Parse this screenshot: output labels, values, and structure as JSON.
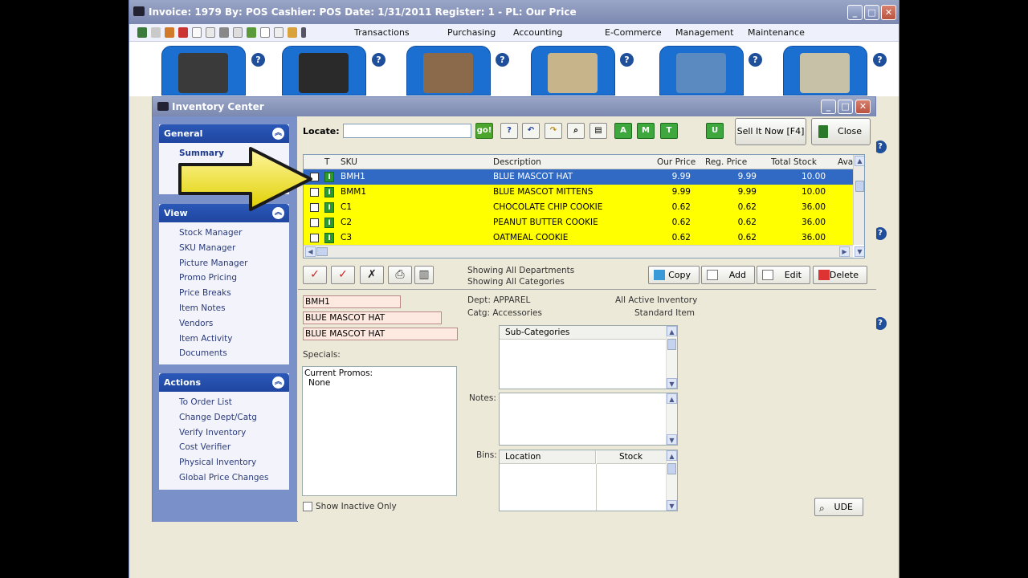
{
  "outer": {
    "title": "Invoice: 1979  By: POS  Cashier: POS  Date:  1/31/2011  Register: 1 - PL: Our Price",
    "menu": [
      "Transactions",
      "Purchasing",
      "Accounting",
      "E-Commerce",
      "Management",
      "Maintenance"
    ],
    "help": "?"
  },
  "window": {
    "title": "Inventory Center"
  },
  "sidebar": {
    "general": {
      "title": "General",
      "items": [
        "Summary",
        "De",
        "Ma"
      ]
    },
    "view": {
      "title": "View",
      "items": [
        "Stock Manager",
        "SKU Manager",
        "Picture Manager",
        "Promo Pricing",
        "Price Breaks",
        "Item Notes",
        "Vendors",
        "Item Activity",
        "Documents"
      ]
    },
    "actions": {
      "title": "Actions",
      "items": [
        "To Order List",
        "Change Dept/Catg",
        "Verify Inventory",
        "Cost Verifier",
        "Physical Inventory",
        "Global Price Changes"
      ]
    }
  },
  "toolbar": {
    "locate_label": "Locate:",
    "locate_value": "",
    "go": "go!",
    "btn_a": "A",
    "btn_m": "M",
    "btn_t": "T",
    "btn_u": "U",
    "sell_it_now": "Sell It Now [F4]",
    "close": "Close"
  },
  "grid": {
    "headers": {
      "t": "T",
      "sku": "SKU",
      "desc": "Description",
      "our": "Our Price",
      "reg": "Reg. Price",
      "stock": "Total Stock",
      "avail": "Ava"
    },
    "rows": [
      {
        "sku": "BMH1",
        "desc": "BLUE MASCOT HAT",
        "our": "9.99",
        "reg": "9.99",
        "stock": "10.00",
        "type": "I"
      },
      {
        "sku": "BMM1",
        "desc": "BLUE MASCOT MITTENS",
        "our": "9.99",
        "reg": "9.99",
        "stock": "10.00",
        "type": "I"
      },
      {
        "sku": "C1",
        "desc": "CHOCOLATE CHIP COOKIE",
        "our": "0.62",
        "reg": "0.62",
        "stock": "36.00",
        "type": "I"
      },
      {
        "sku": "C2",
        "desc": "PEANUT BUTTER COOKIE",
        "our": "0.62",
        "reg": "0.62",
        "stock": "36.00",
        "type": "I"
      },
      {
        "sku": "C3",
        "desc": "OATMEAL COOKIE",
        "our": "0.62",
        "reg": "0.62",
        "stock": "36.00",
        "type": "I"
      }
    ]
  },
  "filters": {
    "line1": "Showing All Departments",
    "line2": "Showing All Categories"
  },
  "actions_bar": {
    "copy": "Copy",
    "add": "Add",
    "edit": "Edit",
    "delete": "Delete"
  },
  "detail": {
    "sku": "BMH1",
    "desc1": "BLUE MASCOT HAT",
    "desc2": "BLUE MASCOT HAT",
    "dept": "Dept: APPAREL",
    "catg": "Catg: Accessories",
    "status": "All Active Inventory",
    "item_type": "Standard Item",
    "subcat_header": "Sub-Categories",
    "specials_label": "Specials:",
    "promos_title": "Current Promos:",
    "promos_value": "None",
    "notes_label": "Notes:",
    "bins_label": "Bins:",
    "bins_col1": "Location",
    "bins_col2": "Stock",
    "show_inactive": "Show Inactive Only",
    "ude": "UDE"
  }
}
